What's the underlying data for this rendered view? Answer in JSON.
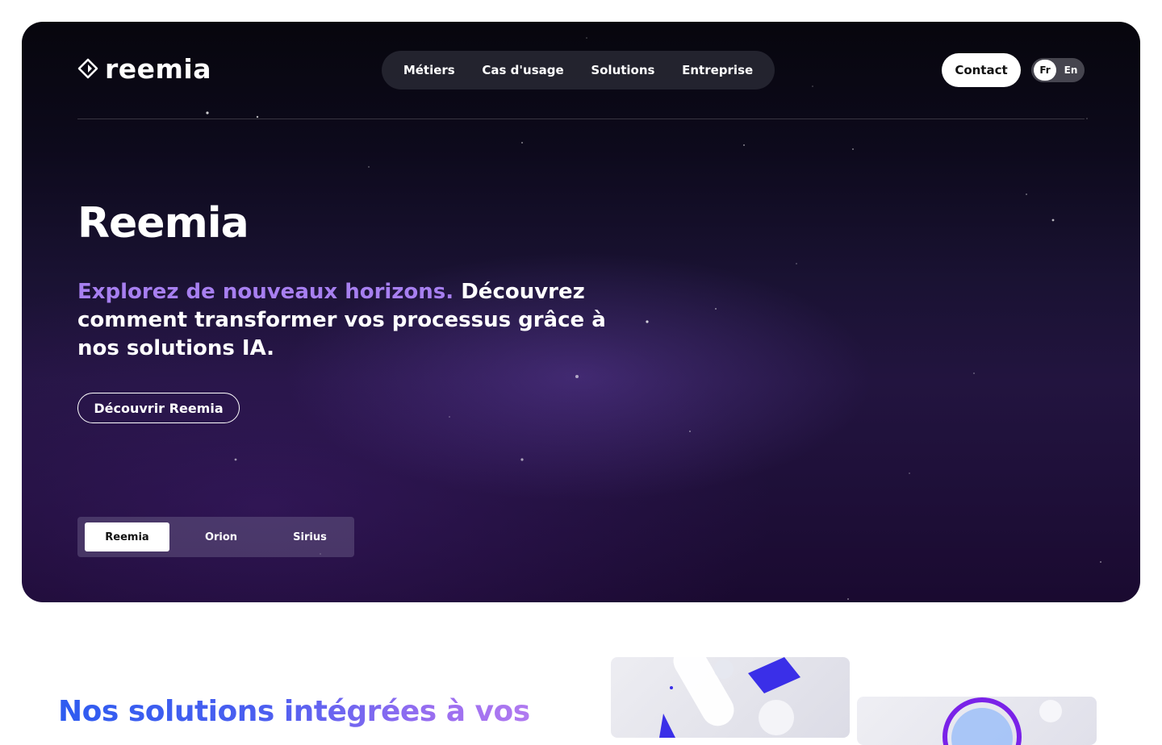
{
  "brand": {
    "name": "reemia",
    "icon": "reemia-logo-icon"
  },
  "nav": {
    "items": [
      {
        "label": "Métiers"
      },
      {
        "label": "Cas d'usage"
      },
      {
        "label": "Solutions"
      },
      {
        "label": "Entreprise"
      }
    ]
  },
  "header": {
    "contact_label": "Contact",
    "languages": [
      {
        "label": "Fr",
        "active": true
      },
      {
        "label": "En",
        "active": false
      }
    ]
  },
  "hero": {
    "title": "Reemia",
    "text_accent": "Explorez de nouveaux horizons.",
    "text_rest": " Découvrez comment transformer vos processus grâce à nos solutions IA.",
    "cta_label": "Découvrir Reemia",
    "tabs": [
      {
        "label": "Reemia",
        "active": true
      },
      {
        "label": "Orion",
        "active": false
      },
      {
        "label": "Sirius",
        "active": false
      }
    ]
  },
  "solutions": {
    "title": "Nos solutions intégrées à vos"
  },
  "colors": {
    "accent_purple": "#a77ff0",
    "gradient_blue": "#2e5cf0",
    "gradient_violet": "#b07af0",
    "hero_dark": "#0d0a1c"
  }
}
